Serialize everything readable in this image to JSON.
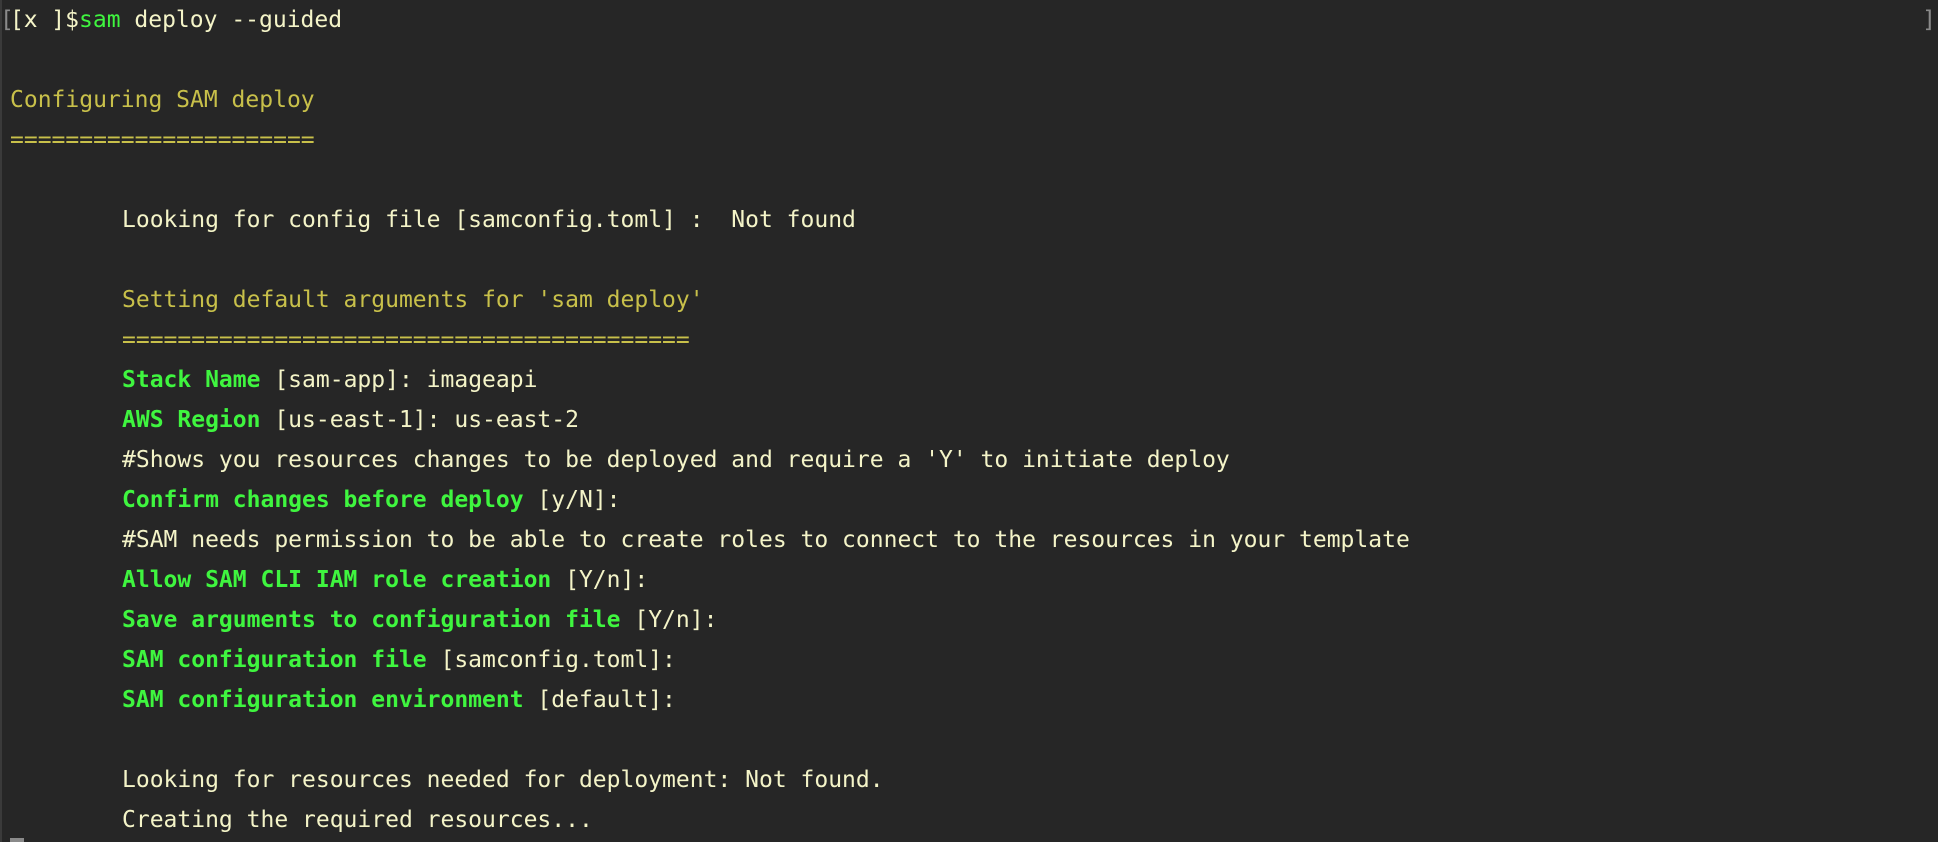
{
  "prompt": {
    "open_bracket": "[",
    "host": "[ⅹ ]$",
    "command": "sam",
    "args": " deploy --guided",
    "close_bracket": "]"
  },
  "header": {
    "title": "Configuring SAM deploy",
    "underline": "======================"
  },
  "config_lookup": "Looking for config file [samconfig.toml] :  Not found",
  "defaults": {
    "title": "Setting default arguments for 'sam deploy'",
    "underline": "========================================="
  },
  "prompts": [
    {
      "label": "Stack Name",
      "rest": " [sam-app]: imageapi"
    },
    {
      "label": "AWS Region",
      "rest": " [us-east-1]: us-east-2"
    },
    {
      "comment": "#Shows you resources changes to be deployed and require a 'Y' to initiate deploy"
    },
    {
      "label": "Confirm changes before deploy",
      "rest": " [y/N]:"
    },
    {
      "comment": "#SAM needs permission to be able to create roles to connect to the resources in your template"
    },
    {
      "label": "Allow SAM CLI IAM role creation",
      "rest": " [Y/n]:"
    },
    {
      "label": "Save arguments to configuration file",
      "rest": " [Y/n]:"
    },
    {
      "label": "SAM configuration file",
      "rest": " [samconfig.toml]:"
    },
    {
      "label": "SAM configuration environment",
      "rest": " [default]:"
    }
  ],
  "resources_lookup": "Looking for resources needed for deployment: Not found.",
  "creating": "Creating the required resources...",
  "colors": {
    "background": "#262626",
    "text": "#f4f4c8",
    "yellow": "#c8c04a",
    "green": "#3ff53f"
  }
}
